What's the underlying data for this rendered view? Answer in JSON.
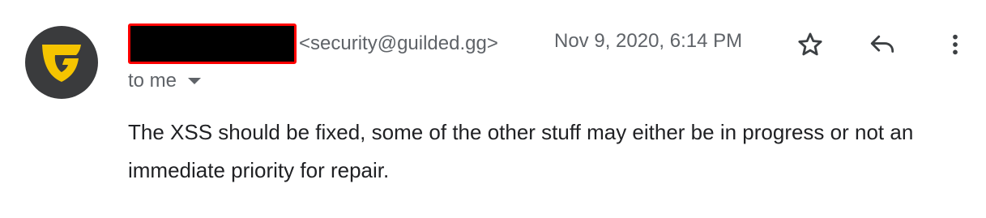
{
  "message": {
    "sender_email": "<security@guilded.gg>",
    "date": "Nov 9, 2020, 6:14 PM",
    "recipient_label": "to me",
    "body": "The XSS should be fixed, some of the other stuff may either be in progress or not an immediate priority for repair."
  },
  "avatar": {
    "icon": "guilded-logo-icon",
    "background": "#3a3b3d",
    "accent": "#f5c400"
  },
  "actions": {
    "star_icon": "star-icon",
    "reply_icon": "reply-icon",
    "more_icon": "more-vert-icon"
  },
  "colors": {
    "redaction_fill": "#000000",
    "redaction_border": "#ff0000",
    "secondary_text": "#5f6368",
    "primary_text": "#202124"
  }
}
